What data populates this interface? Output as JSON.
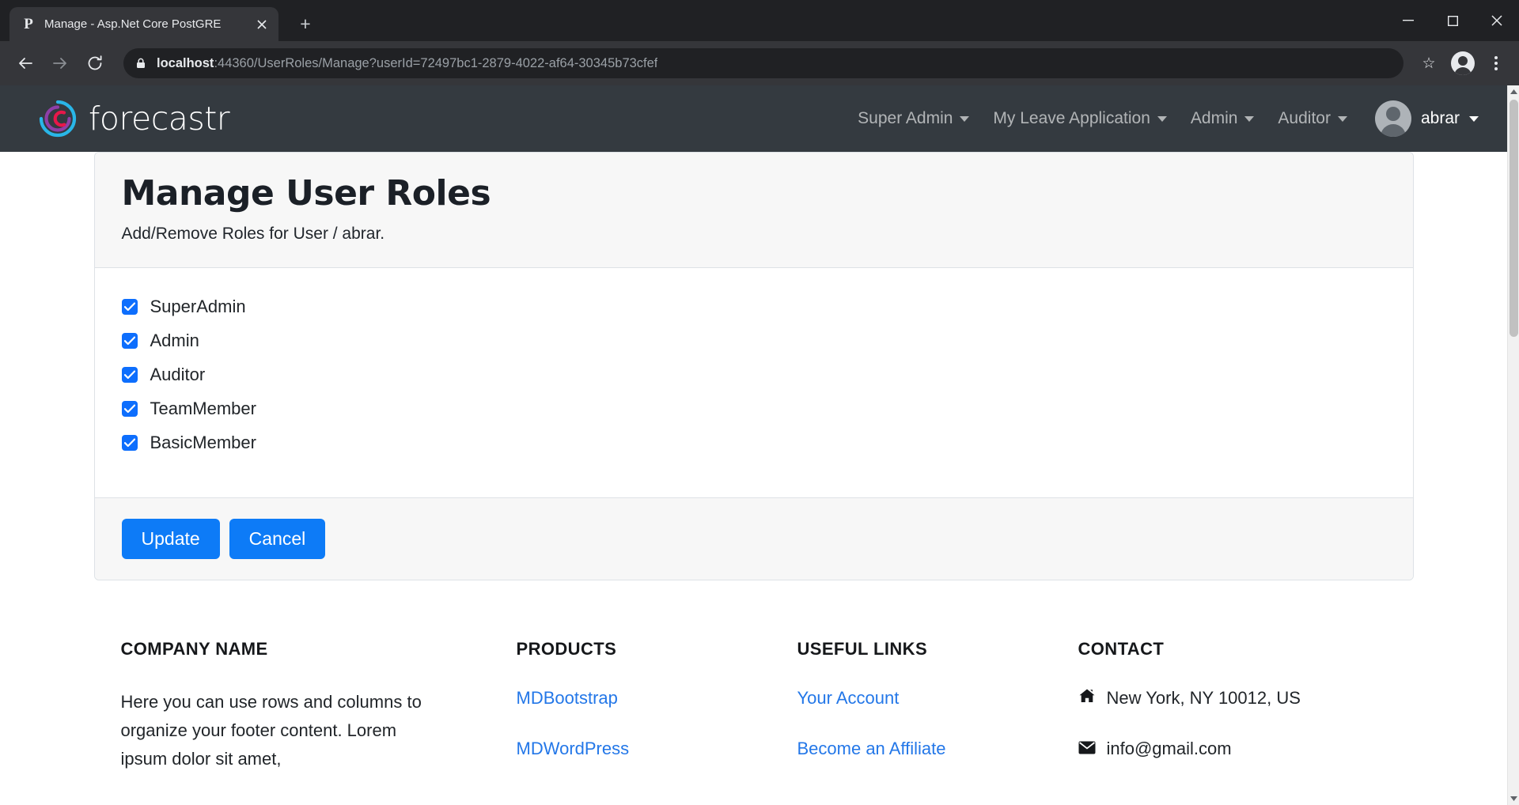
{
  "browser": {
    "tab": {
      "favicon_letter": "P",
      "title": "Manage - Asp.Net Core PostGRE",
      "close_icon": "close-icon"
    },
    "new_tab_label": "+",
    "window_controls": {
      "minimize": "—",
      "maximize": "□",
      "close": "✕"
    },
    "toolbar": {
      "back": "←",
      "forward": "→",
      "reload": "⟳",
      "url_host": "localhost",
      "url_rest": ":44360/UserRoles/Manage?userId=72497bc1-2879-4022-af64-30345b73cfef",
      "bookmark_star": "☆",
      "menu": "kebab-menu-icon"
    }
  },
  "navbar": {
    "brand": "forecastr",
    "items": [
      {
        "label": "Super Admin",
        "has_caret": true
      },
      {
        "label": "My Leave Application",
        "has_caret": true
      },
      {
        "label": "Admin",
        "has_caret": true
      },
      {
        "label": "Auditor",
        "has_caret": true
      }
    ],
    "user": {
      "name": "abrar",
      "has_caret": true
    }
  },
  "card": {
    "title": "Manage User Roles",
    "subtitle": "Add/Remove Roles for User / abrar.",
    "roles": [
      {
        "label": "SuperAdmin",
        "checked": true
      },
      {
        "label": "Admin",
        "checked": true
      },
      {
        "label": "Auditor",
        "checked": true
      },
      {
        "label": "TeamMember",
        "checked": true
      },
      {
        "label": "BasicMember",
        "checked": true
      }
    ],
    "update_label": "Update",
    "cancel_label": "Cancel"
  },
  "footer": {
    "company": {
      "heading": "COMPANY NAME",
      "text": "Here you can use rows and columns to organize your footer content. Lorem ipsum dolor sit amet,"
    },
    "products": {
      "heading": "PRODUCTS",
      "links": [
        "MDBootstrap",
        "MDWordPress"
      ]
    },
    "useful_links": {
      "heading": "USEFUL LINKS",
      "links": [
        "Your Account",
        "Become an Affiliate"
      ]
    },
    "contact": {
      "heading": "CONTACT",
      "address": "New York, NY 10012, US",
      "email": "info@gmail.com"
    }
  },
  "colors": {
    "navbar_bg": "#343a40",
    "accent_blue": "#0d7bf7",
    "checkbox_blue": "#0d6efd",
    "link_blue": "#2377e8"
  }
}
